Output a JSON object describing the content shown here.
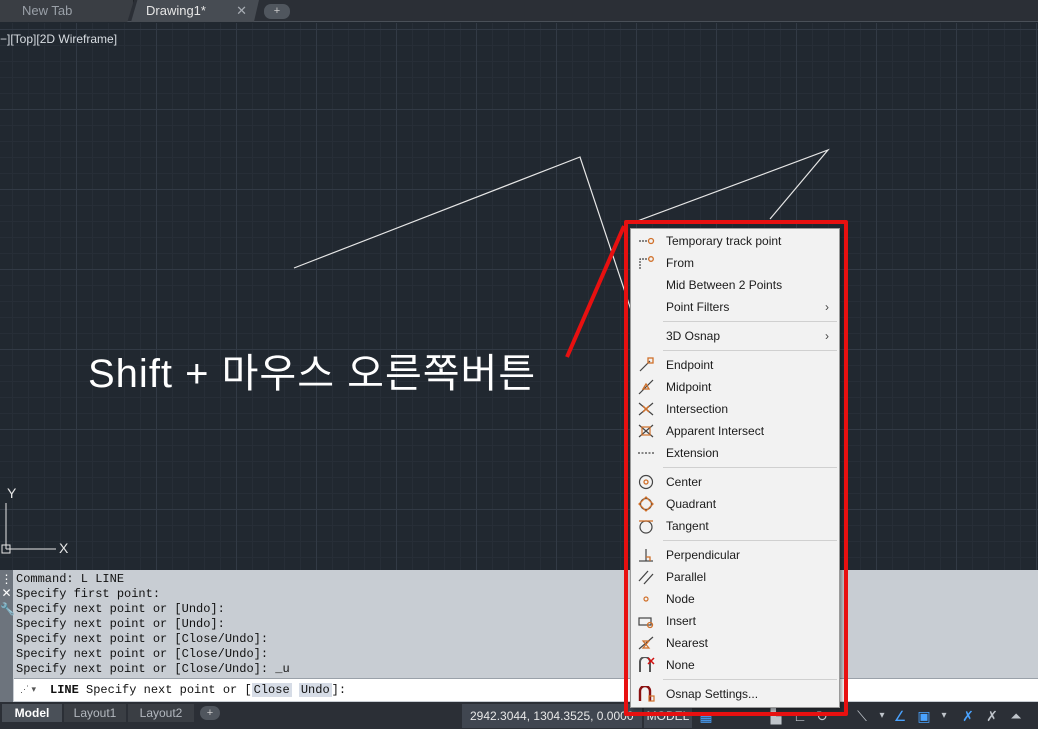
{
  "tabs": {
    "new_tab": "New Tab",
    "drawing": "Drawing1*",
    "close_glyph": "✕",
    "add_glyph": "+"
  },
  "viewport": {
    "label": "−][Top][2D Wireframe]",
    "caption": "Shift + 마우스 오른쪽버튼",
    "ucs_y": "Y",
    "ucs_x": "X"
  },
  "command": {
    "history": [
      "Command: L LINE",
      "Specify first point:",
      "Specify next point or [Undo]:",
      "Specify next point or [Undo]:",
      "Specify next point or [Close/Undo]:",
      "Specify next point or [Close/Undo]:",
      "Specify next point or [Close/Undo]: _u"
    ],
    "input_keyword": "LINE",
    "input_prompt": " Specify next point or [",
    "option_close": "Close",
    "option_undo": "Undo",
    "input_suffix": "]:"
  },
  "layout_tabs": {
    "model": "Model",
    "layout1": "Layout1",
    "layout2": "Layout2",
    "add": "+"
  },
  "status": {
    "coordinates": "2942.3044, 1304.3525, 0.0000",
    "model_button": "MODEL"
  },
  "menu": {
    "items": [
      {
        "label": "Temporary track point",
        "icon": "temporary-track-point-icon"
      },
      {
        "label": "From",
        "icon": "from-icon"
      },
      {
        "label": "Mid Between 2 Points",
        "icon": "none"
      },
      {
        "label": "Point Filters",
        "icon": "none",
        "submenu": true
      },
      {
        "label": "3D Osnap",
        "icon": "none",
        "submenu": true
      },
      {
        "label": "Endpoint",
        "icon": "endpoint-icon"
      },
      {
        "label": "Midpoint",
        "icon": "midpoint-icon"
      },
      {
        "label": "Intersection",
        "icon": "intersection-icon"
      },
      {
        "label": "Apparent Intersect",
        "icon": "apparent-intersect-icon"
      },
      {
        "label": "Extension",
        "icon": "extension-icon"
      },
      {
        "label": "Center",
        "icon": "center-icon"
      },
      {
        "label": "Quadrant",
        "icon": "quadrant-icon"
      },
      {
        "label": "Tangent",
        "icon": "tangent-icon"
      },
      {
        "label": "Perpendicular",
        "icon": "perpendicular-icon"
      },
      {
        "label": "Parallel",
        "icon": "parallel-icon"
      },
      {
        "label": "Node",
        "icon": "node-icon"
      },
      {
        "label": "Insert",
        "icon": "insert-icon"
      },
      {
        "label": "Nearest",
        "icon": "nearest-icon"
      },
      {
        "label": "None",
        "icon": "none-osnap-icon"
      },
      {
        "label": "Osnap Settings...",
        "icon": "osnap-settings-icon"
      }
    ],
    "submenu_arrow": "›"
  },
  "colors": {
    "highlight_red": "#e81010",
    "icon_orange": "#d0702a",
    "viewport_bg": "#212830"
  }
}
